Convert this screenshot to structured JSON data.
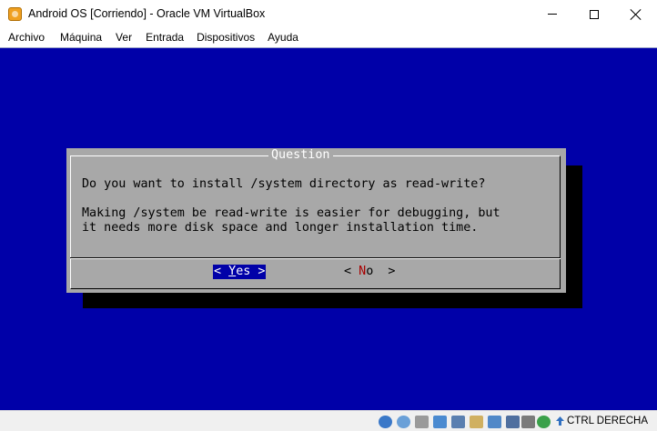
{
  "window": {
    "title": "Android OS [Corriendo] - Oracle VM VirtualBox",
    "icon": "virtualbox-icon"
  },
  "menu": {
    "items": [
      "Archivo",
      "Máquina",
      "Ver",
      "Entrada",
      "Dispositivos",
      "Ayuda"
    ]
  },
  "dialog": {
    "title": "Question",
    "question": "Do you want to install /system directory as read-write?",
    "info_line1": "Making /system be read-write is easier for debugging, but",
    "info_line2": "it needs more disk space and longer installation time.",
    "yes_button": {
      "left": "< ",
      "hotkey": "Y",
      "rest": "es >"
    },
    "no_button": {
      "left": "< ",
      "hotkey": "N",
      "rest": "o  >"
    }
  },
  "statusbar": {
    "host_key": "CTRL DERECHA",
    "icons": [
      "hard-disk-icon",
      "optical-drive-icon",
      "audio-icon",
      "network-icon",
      "usb-icon",
      "shared-folders-icon",
      "display-icon",
      "video-capture-icon",
      "cpu-icon",
      "mouse-integration-icon",
      "keyboard-icon"
    ]
  },
  "colors": {
    "vm_background": "#0000a8",
    "dialog_background": "#a8a8a8",
    "dialog_shadow": "#000000",
    "hotkey_no": "#a80000"
  }
}
